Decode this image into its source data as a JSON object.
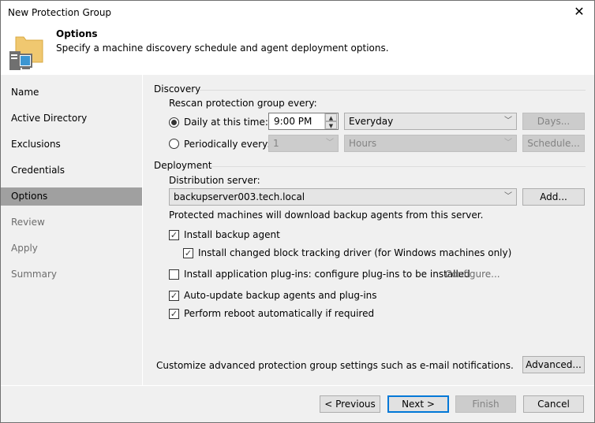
{
  "window": {
    "title": "New Protection Group",
    "close_icon": "close-icon"
  },
  "header": {
    "icon": "protection-group-icon",
    "title": "Options",
    "subtitle": "Specify a machine discovery schedule and agent deployment options."
  },
  "sidebar": {
    "items": [
      {
        "label": "Name",
        "state": "enabled"
      },
      {
        "label": "Active Directory",
        "state": "enabled"
      },
      {
        "label": "Exclusions",
        "state": "enabled"
      },
      {
        "label": "Credentials",
        "state": "enabled"
      },
      {
        "label": "Options",
        "state": "active"
      },
      {
        "label": "Review",
        "state": "disabled"
      },
      {
        "label": "Apply",
        "state": "disabled"
      },
      {
        "label": "Summary",
        "state": "disabled"
      }
    ]
  },
  "discovery": {
    "group_label": "Discovery",
    "rescan_label": "Rescan protection group every:",
    "daily": {
      "label": "Daily at this time:",
      "selected": true,
      "time_value": "9:00 PM",
      "frequency_value": "Everyday",
      "days_button": "Days..."
    },
    "periodic": {
      "label": "Periodically every:",
      "selected": false,
      "interval_value": "1",
      "unit_value": "Hours",
      "schedule_button": "Schedule..."
    }
  },
  "deployment": {
    "group_label": "Deployment",
    "server_label": "Distribution server:",
    "server_value": "backupserver003.tech.local",
    "add_button": "Add...",
    "server_hint": "Protected machines will download backup agents from this server.",
    "options": [
      {
        "label": "Install backup agent",
        "checked": true
      },
      {
        "label": "Install changed block tracking driver (for Windows machines only)",
        "checked": true
      },
      {
        "label": "Install application plug-ins: configure plug-ins to be installed",
        "checked": false
      },
      {
        "label": "Auto-update backup agents and plug-ins",
        "checked": true
      },
      {
        "label": "Perform reboot automatically if required",
        "checked": true
      }
    ],
    "configure_link": "Configure..."
  },
  "advanced": {
    "text": "Customize advanced protection group settings such as e-mail notifications.",
    "button": "Advanced..."
  },
  "footer": {
    "previous": "< Previous",
    "next": "Next >",
    "finish": "Finish",
    "cancel": "Cancel"
  }
}
